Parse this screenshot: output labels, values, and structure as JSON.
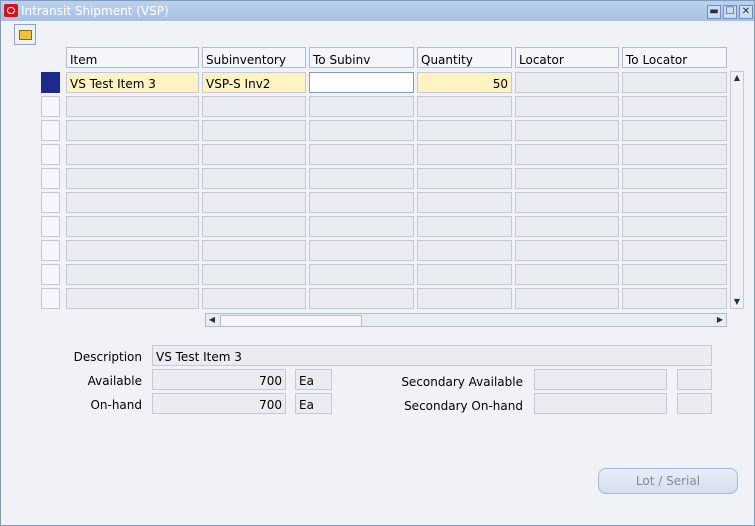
{
  "window": {
    "title": "Intransit Shipment (VSP)",
    "minimize": "▬",
    "maximize": "☐",
    "close": "✕"
  },
  "toolbar": {
    "icon": "folder-open-icon"
  },
  "columns": [
    "Item",
    "Subinventory",
    "To Subinv",
    "Quantity",
    "Locator",
    "To Locator"
  ],
  "rows": [
    {
      "item": "VS Test Item 3",
      "subinventory": "VSP-S Inv2",
      "to_subinv": "",
      "quantity": "50",
      "locator": "",
      "to_locator": ""
    }
  ],
  "details": {
    "description_label": "Description",
    "description": "VS Test Item 3",
    "available_label": "Available",
    "available": "700",
    "available_uom": "Ea",
    "onhand_label": "On-hand",
    "onhand": "700",
    "onhand_uom": "Ea",
    "sec_available_label": "Secondary Available",
    "sec_available": "",
    "sec_onhand_label": "Secondary On-hand",
    "sec_onhand": ""
  },
  "buttons": {
    "lot_serial": "Lot / Serial"
  },
  "colors": {
    "titlebar": "#a8c0e3",
    "current_row": "#fff3c4",
    "row_indicator": "#1c2a8c"
  }
}
